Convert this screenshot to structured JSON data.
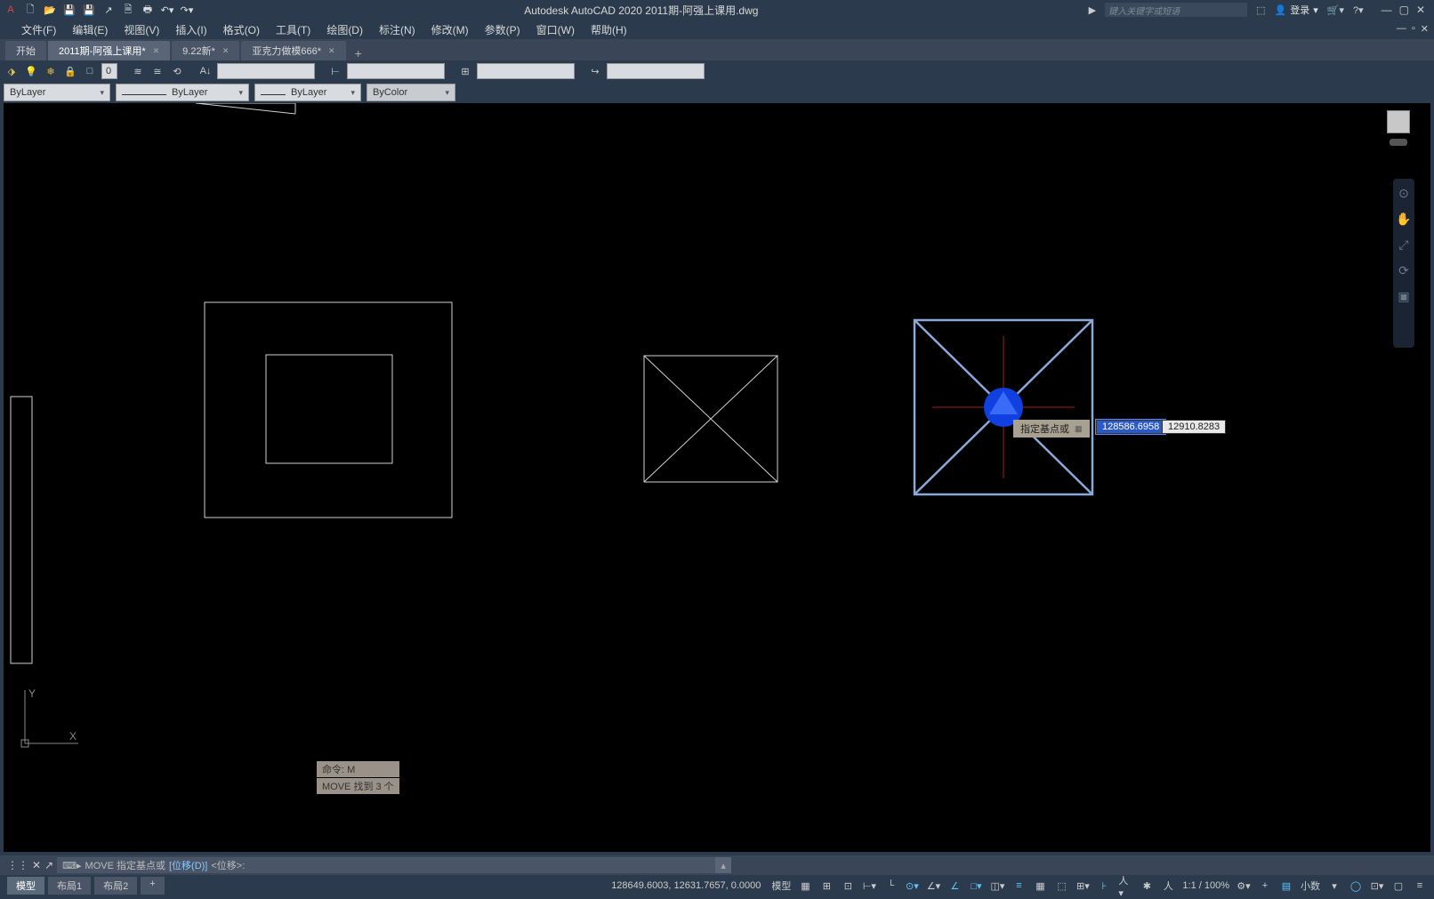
{
  "titlebar": {
    "app_title": "Autodesk AutoCAD 2020   2011期-阿强上课用.dwg",
    "search_placeholder": "键入关键字或短语",
    "signin_label": "登录"
  },
  "menus": [
    "文件(F)",
    "编辑(E)",
    "视图(V)",
    "插入(I)",
    "格式(O)",
    "工具(T)",
    "绘图(D)",
    "标注(N)",
    "修改(M)",
    "参数(P)",
    "窗口(W)",
    "帮助(H)"
  ],
  "tabs": [
    {
      "label": "开始",
      "closable": false,
      "active": false
    },
    {
      "label": "2011期-阿强上课用*",
      "closable": true,
      "active": true
    },
    {
      "label": "9.22新*",
      "closable": true,
      "active": false
    },
    {
      "label": "亚克力做模666*",
      "closable": true,
      "active": false
    }
  ],
  "props": {
    "layer_state": "ByLayer",
    "linetype": "ByLayer",
    "lineweight": "ByLayer",
    "plotstyle": "ByColor"
  },
  "canvas": {
    "tooltip_text": "指定基点或",
    "dyn_x": "128586.6958",
    "dyn_y": "12910.8283"
  },
  "cmd_history": [
    "命令: M",
    "MOVE 找到 3 个"
  ],
  "cmdline": {
    "prefix": "MOVE 指定基点或 ",
    "option": "[位移(D)]",
    "default": " <位移>:"
  },
  "layout_tabs": {
    "model": "模型",
    "layout1": "布局1",
    "layout2": "布局2"
  },
  "status": {
    "coords": "128649.6003, 12631.7657, 0.0000",
    "model_btn": "模型",
    "scale": "1:1 / 100%",
    "units": "小数"
  }
}
